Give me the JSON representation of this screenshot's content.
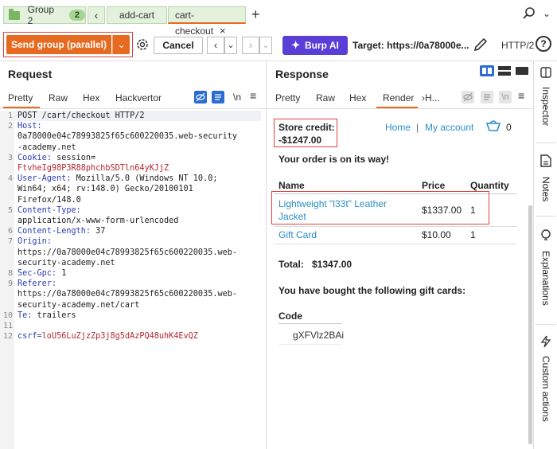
{
  "tabs": {
    "group_label": "Group 2",
    "group_count": "2",
    "collapse_glyph": "‹",
    "items": [
      {
        "label": "add-cart"
      },
      {
        "label": "cart-checkout",
        "close": "×"
      }
    ],
    "add_glyph": "+"
  },
  "toolbar": {
    "send_label": "Send group (parallel)",
    "dropdown_glyph": "⌄",
    "cancel_label": "Cancel",
    "back_glyph": "‹",
    "back_menu_glyph": "⌄",
    "forward_glyph": "›",
    "forward_menu_glyph": "⌄",
    "burp_ai_label": "Burp AI",
    "target_label": "Target: https://0a78000e...",
    "protocol": "HTTP/2",
    "help_glyph": "?"
  },
  "request": {
    "title": "Request",
    "tabs": [
      "Pretty",
      "Raw",
      "Hex",
      "Hackvertor"
    ],
    "active_tab": "Pretty",
    "newline_toggle": "\\n",
    "lines": [
      {
        "n": "1",
        "text": "POST /cart/checkout HTTP/2"
      },
      {
        "n": "2",
        "key": "Host:",
        "value": ""
      },
      {
        "n": "",
        "value": "0a78000e04c78993825f65c600220035.web-security"
      },
      {
        "n": "",
        "value": "-academy.net"
      },
      {
        "n": "3",
        "key": "Cookie:",
        "value": " session="
      },
      {
        "n": "",
        "cookie": "FtvheIg98P3R88phchbSDTln64yKJjZ"
      },
      {
        "n": "4",
        "key": "User-Agent:",
        "value": " Mozilla/5.0 (Windows NT 10.0;"
      },
      {
        "n": "",
        "value": "Win64; x64; rv:148.0) Gecko/20100101"
      },
      {
        "n": "",
        "value": "Firefox/148.0"
      },
      {
        "n": "5",
        "key": "Content-Type:",
        "value": ""
      },
      {
        "n": "",
        "value": "application/x-www-form-urlencoded"
      },
      {
        "n": "6",
        "key": "Content-Length:",
        "value": " 37"
      },
      {
        "n": "7",
        "key": "Origin:",
        "value": ""
      },
      {
        "n": "",
        "value": "https://0a78000e04c78993825f65c600220035.web-"
      },
      {
        "n": "",
        "value": "security-academy.net"
      },
      {
        "n": "8",
        "key": "Sec-Gpc:",
        "value": " 1"
      },
      {
        "n": "9",
        "key": "Referer:",
        "value": ""
      },
      {
        "n": "",
        "value": "https://0a78000e04c78993825f65c600220035.web-"
      },
      {
        "n": "",
        "value": "security-academy.net/cart"
      },
      {
        "n": "10",
        "key": "Te:",
        "value": " trailers"
      },
      {
        "n": "11",
        "value": ""
      },
      {
        "n": "12",
        "csrf_key": "csrf=",
        "csrf_value": "loU56LuZjzZp3j8g5dAzPQ48uhK4EvQZ"
      }
    ]
  },
  "response": {
    "title": "Response",
    "tabs": [
      "Pretty",
      "Raw",
      "Hex",
      "Render",
      "›H..."
    ],
    "active_tab": "Render",
    "newline_toggle": "\\n",
    "page": {
      "store_credit_label": "Store credit:",
      "store_credit_value": "-$1247.00",
      "nav_home": "Home",
      "nav_sep": "|",
      "nav_account": "My account",
      "cart_count": "0",
      "order_message": "Your order is on its way!",
      "table_headers": [
        "Name",
        "Price",
        "Quantity"
      ],
      "rows": [
        {
          "name_line1": "Lightweight \"l33t\" Leather",
          "name_line2": "Jacket",
          "price": "$1337.00",
          "qty": "1"
        },
        {
          "name_line1": "Gift Card",
          "name_line2": "",
          "price": "$10.00",
          "qty": "1"
        }
      ],
      "total_label": "Total:",
      "total_value": "$1347.00",
      "gift_cards_heading": "You have bought the following gift cards:",
      "code_header": "Code",
      "gift_code": "gXFVlz2BAi"
    }
  },
  "sidebar": {
    "items": [
      "Inspector",
      "Notes",
      "Explanations",
      "Custom actions"
    ]
  },
  "colors": {
    "accent": "#e66a1f",
    "burp_ai": "#5a3fd6",
    "highlight_box": "#e0403f",
    "link": "#2a8ec7"
  }
}
